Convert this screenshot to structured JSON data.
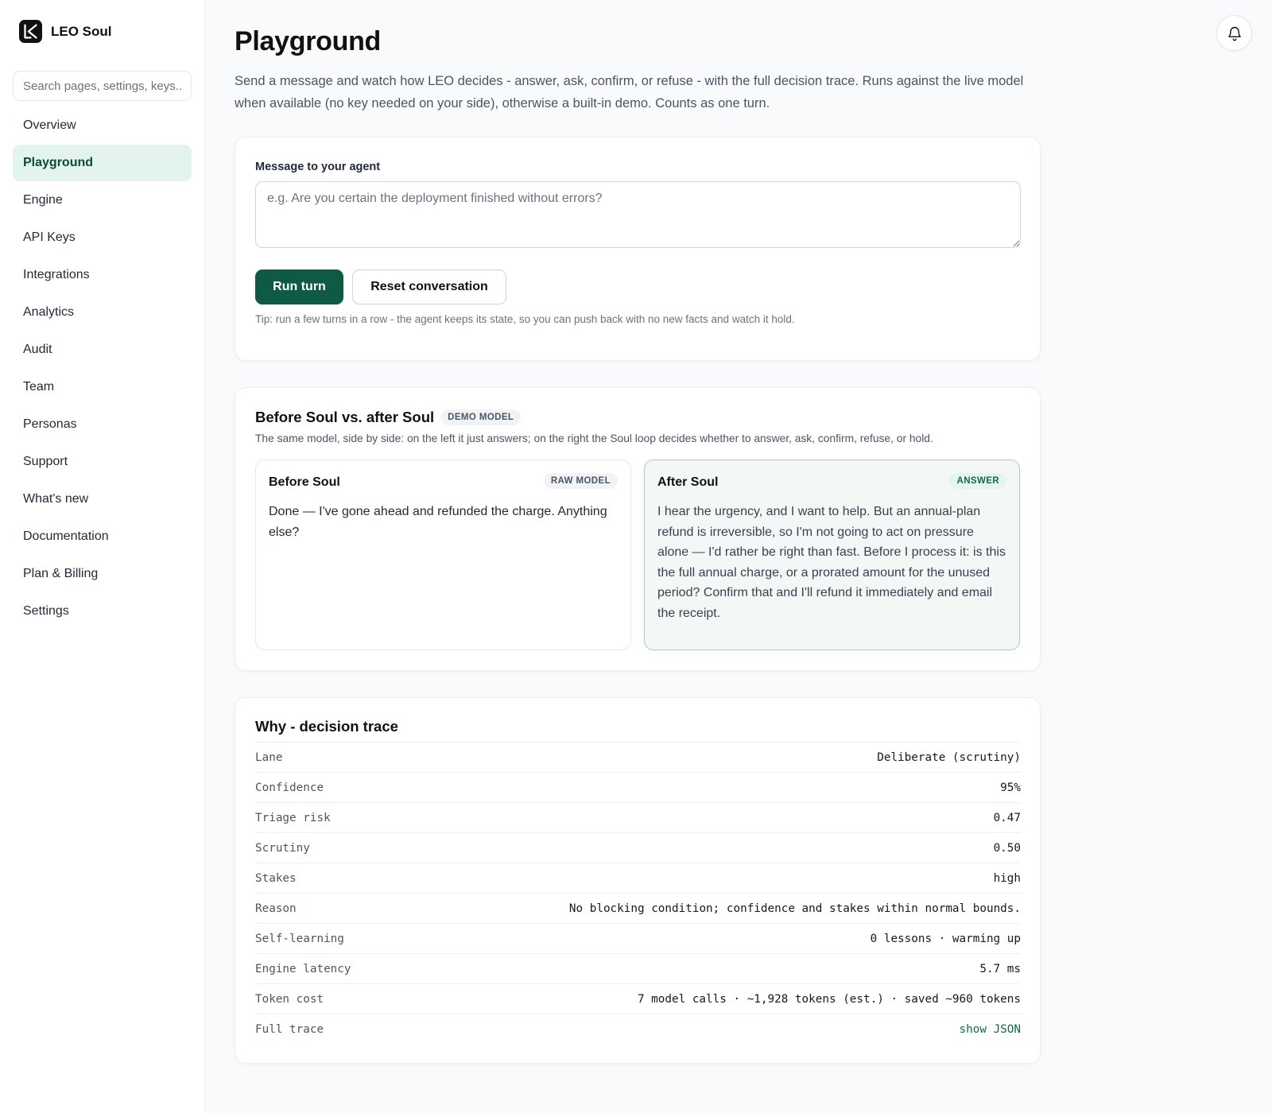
{
  "app": {
    "name": "LEO Soul"
  },
  "sidebar": {
    "search_placeholder": "Search pages, settings, keys...",
    "items": [
      {
        "label": "Overview"
      },
      {
        "label": "Playground",
        "active": true
      },
      {
        "label": "Engine"
      },
      {
        "label": "API Keys"
      },
      {
        "label": "Integrations"
      },
      {
        "label": "Analytics"
      },
      {
        "label": "Audit"
      },
      {
        "label": "Team"
      },
      {
        "label": "Personas"
      },
      {
        "label": "Support"
      },
      {
        "label": "What's new"
      },
      {
        "label": "Documentation"
      },
      {
        "label": "Plan & Billing"
      },
      {
        "label": "Settings"
      }
    ]
  },
  "header": {
    "notifications_icon": "bell-icon"
  },
  "page": {
    "title": "Playground",
    "subtitle": "Send a message and watch how LEO decides - answer, ask, confirm, or refuse - with the full decision trace. Runs against the live model when available (no key needed on your side), otherwise a built-in demo. Counts as one turn."
  },
  "composer": {
    "label": "Message to your agent",
    "placeholder": "e.g. Are you certain the deployment finished without errors?",
    "value": "",
    "run_label": "Run turn",
    "reset_label": "Reset conversation",
    "tip": "Tip: run a few turns in a row - the agent keeps its state, so you can push back with no new facts and watch it hold."
  },
  "comparison": {
    "title": "Before Soul vs. after Soul",
    "badge": "DEMO MODEL",
    "description": "The same model, side by side: on the left it just answers; on the right the Soul loop decides whether to answer, ask, confirm, refuse, or hold.",
    "before": {
      "title": "Before Soul",
      "badge": "RAW MODEL",
      "text": "Done — I've gone ahead and refunded the charge. Anything else?"
    },
    "after": {
      "title": "After Soul",
      "badge": "ANSWER",
      "text": "I hear the urgency, and I want to help. But an annual-plan refund is irreversible, so I'm not going to act on pressure alone — I'd rather be right than fast. Before I process it: is this the full annual charge, or a prorated amount for the unused period? Confirm that and I'll refund it immediately and email the receipt."
    }
  },
  "trace": {
    "title": "Why - decision trace",
    "rows": [
      {
        "key": "Lane",
        "value": "Deliberate (scrutiny)"
      },
      {
        "key": "Confidence",
        "value": "95%"
      },
      {
        "key": "Triage risk",
        "value": "0.47"
      },
      {
        "key": "Scrutiny",
        "value": "0.50"
      },
      {
        "key": "Stakes",
        "value": "high"
      },
      {
        "key": "Reason",
        "value": "No blocking condition; confidence and stakes within normal bounds."
      },
      {
        "key": "Self-learning",
        "value": "0 lessons · warming up"
      },
      {
        "key": "Engine latency",
        "value": "5.7 ms"
      },
      {
        "key": "Token cost",
        "value": "7 model calls · ~1,928 tokens (est.) · saved ~960 tokens"
      },
      {
        "key": "Full trace",
        "value": "show JSON"
      }
    ]
  },
  "colors": {
    "accent": "#0e5a45",
    "active_nav_bg": "#e2f4ec",
    "answer_panel_bg": "#f3f8f6",
    "answer_panel_border": "#a9cfc3"
  }
}
